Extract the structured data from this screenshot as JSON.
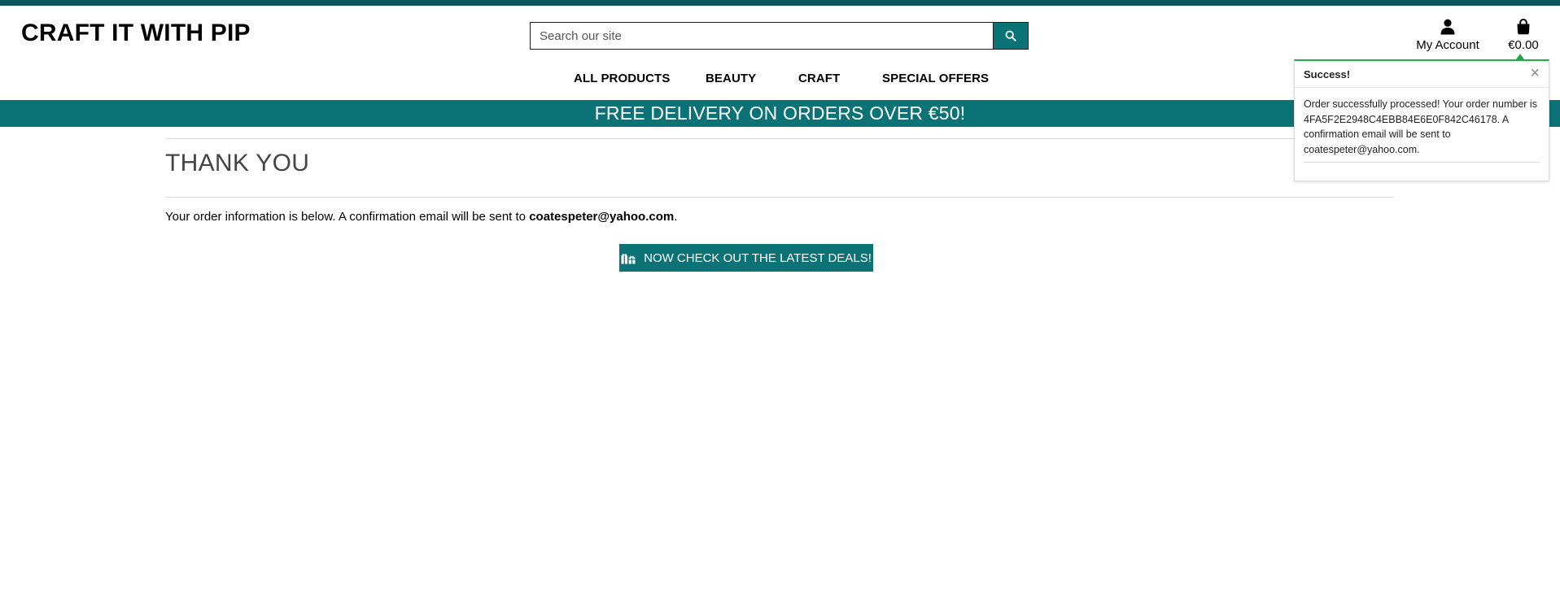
{
  "brand": {
    "name": "CRAFT IT WITH PIP"
  },
  "search": {
    "placeholder": "Search our site",
    "icon": "search-icon"
  },
  "header": {
    "account_label": "My Account",
    "account_icon": "user-icon",
    "bag_total": "€0.00",
    "bag_icon": "shopping-bag-icon"
  },
  "nav": {
    "items": [
      {
        "label": "ALL PRODUCTS"
      },
      {
        "label": "BEAUTY"
      },
      {
        "label": "CRAFT"
      },
      {
        "label": "SPECIAL OFFERS"
      }
    ]
  },
  "banner": {
    "text": "FREE DELIVERY ON ORDERS OVER €50!"
  },
  "main": {
    "title": "THANK YOU",
    "info_prefix": "Your order information is below. A confirmation email will be sent to ",
    "email": "coatespeter@yahoo.com",
    "info_suffix": ".",
    "deals_button": "NOW CHECK OUT THE LATEST DEALS!",
    "deals_icon": "gifts-icon"
  },
  "toast": {
    "title": "Success!",
    "close": "×",
    "message": "Order successfully processed! Your order number is 4FA5F2E2948C4EBB84E6E0F842C46178. A confirmation email will be sent to coatespeter@yahoo.com."
  },
  "colors": {
    "primary": "#0b7275",
    "top_strip": "#08575a",
    "success": "#28a745"
  }
}
